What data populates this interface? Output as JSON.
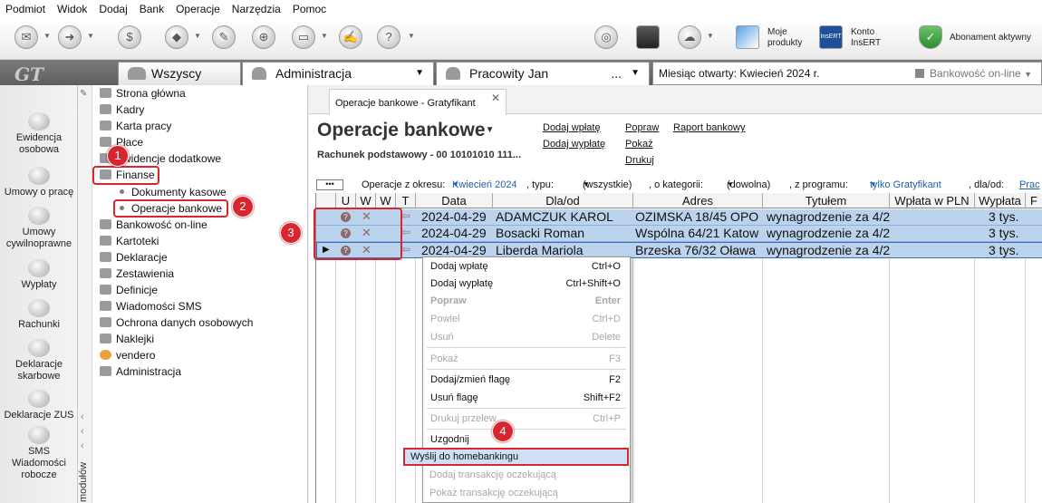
{
  "menubar": [
    "Podmiot",
    "Widok",
    "Dodaj",
    "Bank",
    "Operacje",
    "Narzędzia",
    "Pomoc"
  ],
  "toolbar": {
    "moje_produkty_1": "Moje",
    "moje_produkty_2": "produkty",
    "konto_1": "Konto",
    "konto_2": "InsERT",
    "abonament": "Abonament aktywny",
    "insert_logo": "InsERT"
  },
  "logo": "GT",
  "tabs": {
    "wszyscy": "Wszyscy",
    "administracja": "Administracja",
    "pracownik": "Pracowity Jan",
    "pracownik_dots": "...",
    "month_label": "Miesiąc otwarty: Kwiecień 2024 r.",
    "bank_label": "Bankowość on-line"
  },
  "leftbar": [
    {
      "label": "Ewidencja osobowa",
      "icon": "people-icon"
    },
    {
      "label": "Umowy o pracę",
      "icon": "contract-icon"
    },
    {
      "label": "Umowy cywilnoprawne",
      "icon": "civil-contract-icon"
    },
    {
      "label": "Wypłaty",
      "icon": "payout-icon"
    },
    {
      "label": "Rachunki",
      "icon": "bill-icon"
    },
    {
      "label": "Deklaracje skarbowe",
      "icon": "tax-icon"
    },
    {
      "label": "Deklaracje ZUS",
      "icon": "zus-icon"
    },
    {
      "label": "SMS Wiadomości robocze",
      "icon": "sms-icon"
    }
  ],
  "modules_label": "modułów",
  "tree": {
    "items": [
      "Strona główna",
      "Kadry",
      "Karta pracy",
      "Płace",
      "Ewidencje dodatkowe",
      "Finanse"
    ],
    "sub": [
      "Dokumenty kasowe",
      "Operacje bankowe"
    ],
    "rest": [
      "Bankowość on-line",
      "Kartoteki",
      "Deklaracje",
      "Zestawienia",
      "Definicje",
      "Wiadomości SMS",
      "Ochrona danych osobowych",
      "Naklejki",
      "vendero",
      "Administracja"
    ]
  },
  "badges": [
    "1",
    "2",
    "3",
    "4"
  ],
  "main": {
    "tab_title": "Operacje bankowe - Gratyfikant",
    "title": "Operacje bankowe",
    "account": "Rachunek podstawowy - 00 10101010 111...",
    "links": [
      "Dodaj wpłatę",
      "Dodaj wypłatę",
      "Popraw",
      "Pokaż",
      "Drukuj",
      "Raport bankowy"
    ]
  },
  "filter": {
    "dots": "•••",
    "okres_label": "Operacje z okresu:",
    "okres_value": "Kwiecień 2024",
    "typ_label": ", typu:",
    "typ_value": "(wszystkie)",
    "kat_label": ", o kategorii:",
    "kat_value": "(dowolna)",
    "prog_label": ", z programu:",
    "prog_value": "tylko Gratyfikant",
    "dla_label": ", dla/od:",
    "dla_value": "Prac"
  },
  "columns": [
    "U",
    "W",
    "W",
    "T",
    "Data",
    "Dla/od",
    "Adres",
    "Tytułem",
    "Wpłata w PLN",
    "Wypłata",
    "F"
  ],
  "rows": [
    {
      "date": "2024-04-29",
      "name": "ADAMCZUK KAROL",
      "address": "OZIMSKA 18/45 OPO",
      "title": "wynagrodzenie za 4/2",
      "wyplata": "3 tys."
    },
    {
      "date": "2024-04-29",
      "name": "Bosacki Roman",
      "address": "Wspólna 64/21 Katow",
      "title": "wynagrodzenie za 4/2",
      "wyplata": "3 tys."
    },
    {
      "date": "2024-04-29",
      "name": "Liberda Mariola",
      "address": "Brzeska 76/32 Oława",
      "title": "wynagrodzenie za 4/2",
      "wyplata": "3 tys."
    }
  ],
  "context_menu": [
    {
      "label": "Dodaj wpłatę",
      "shortcut": "Ctrl+O",
      "state": "normal"
    },
    {
      "label": "Dodaj wypłatę",
      "shortcut": "Ctrl+Shift+O",
      "state": "normal"
    },
    {
      "label": "Popraw",
      "shortcut": "Enter",
      "state": "disabled-bold"
    },
    {
      "label": "Powiel",
      "shortcut": "Ctrl+D",
      "state": "disabled"
    },
    {
      "label": "Usuń",
      "shortcut": "Delete",
      "state": "disabled"
    },
    {
      "label": "Pokaż",
      "shortcut": "F3",
      "state": "disabled"
    },
    {
      "label": "Dodaj/zmień flagę",
      "shortcut": "F2",
      "state": "normal"
    },
    {
      "label": "Usuń flagę",
      "shortcut": "Shift+F2",
      "state": "normal"
    },
    {
      "label": "Drukuj przelew",
      "shortcut": "Ctrl+P",
      "state": "disabled"
    },
    {
      "label": "Uzgodnij",
      "shortcut": "",
      "state": "normal"
    },
    {
      "label": "Wyślij do homebankingu",
      "shortcut": "",
      "state": "highlight"
    },
    {
      "label": "Dodaj transakcję oczekującą",
      "shortcut": "",
      "state": "disabled"
    },
    {
      "label": "Pokaż transakcję oczekującą",
      "shortcut": "",
      "state": "disabled"
    }
  ],
  "colors": {
    "highlight": "#d8262f",
    "row_selected": "#bcd3ee",
    "link_blue": "#1f5fb4"
  }
}
